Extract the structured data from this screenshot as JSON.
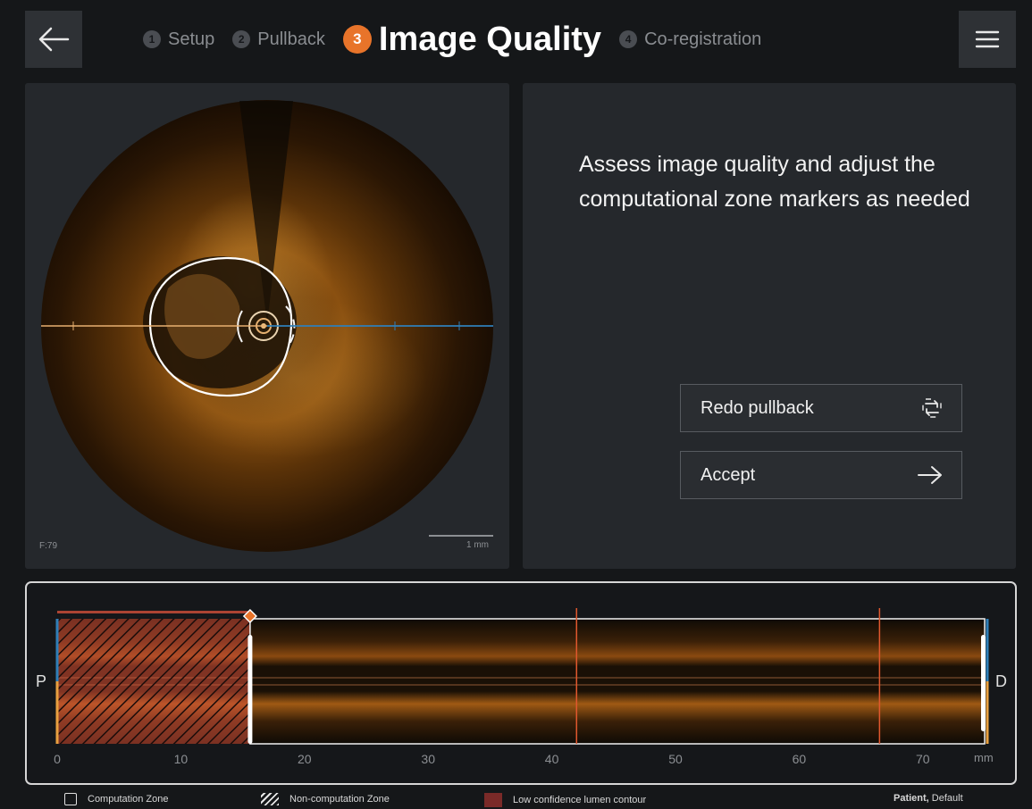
{
  "header": {
    "steps": [
      {
        "num": "1",
        "label": "Setup"
      },
      {
        "num": "2",
        "label": "Pullback"
      },
      {
        "num": "3",
        "label": "Image Quality"
      },
      {
        "num": "4",
        "label": "Co-registration"
      }
    ],
    "active_step": 3
  },
  "image_view": {
    "frame_label": "F:79",
    "scale_label": "1 mm"
  },
  "info": {
    "instruction": "Assess image quality and adjust the computational zone markers as needed",
    "redo_label": "Redo pullback",
    "accept_label": "Accept"
  },
  "longitudinal": {
    "proximal_label": "P",
    "distal_label": "D",
    "unit": "mm",
    "ticks": [
      "0",
      "10",
      "20",
      "30",
      "40",
      "50",
      "60",
      "70"
    ],
    "axis_max_mm": 75,
    "computation_zone_start_mm": 15.6,
    "computation_zone_end_mm": 75,
    "frame_marker_mm": [
      42,
      66.5
    ]
  },
  "legend": {
    "computation": "Computation Zone",
    "non_computation": "Non-computation Zone",
    "low_confidence": "Low confidence lumen contour",
    "patient_label": "Patient,",
    "patient_value": "Default"
  },
  "colors": {
    "accent": "#e8742a",
    "panel": "#25282c",
    "proximal_marker": "#2f7fb8",
    "low_confidence": "#7a2a28"
  }
}
